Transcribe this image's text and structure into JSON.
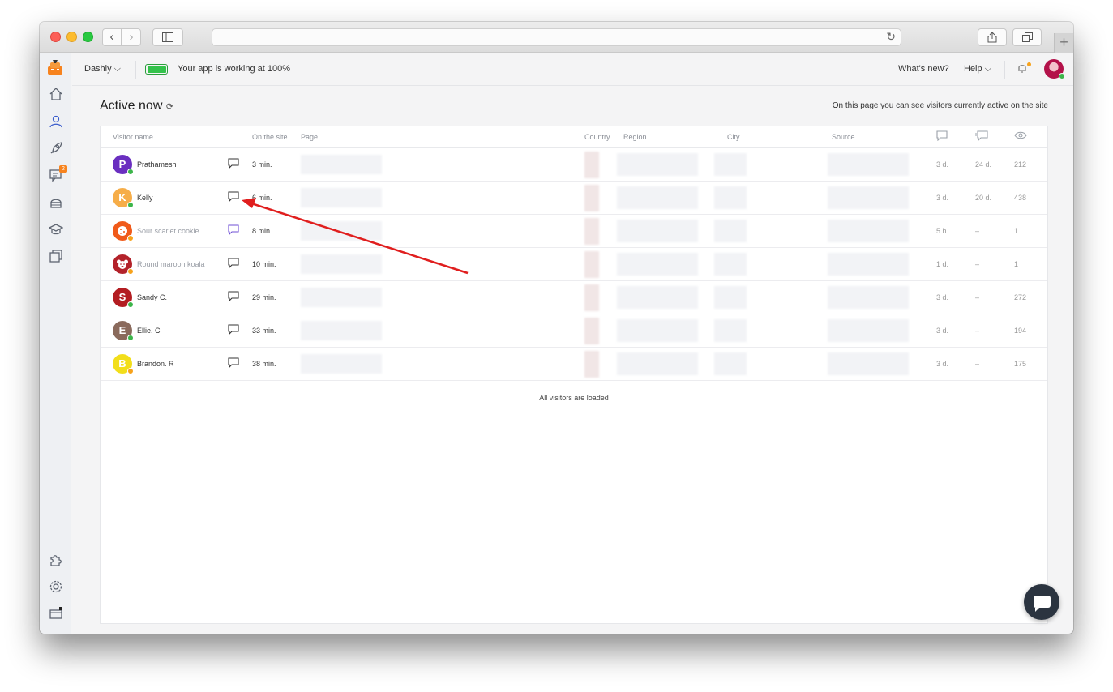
{
  "app": {
    "project": "Dashly ⌵",
    "status": "Your app is working at 100%",
    "battery_level": 1.0,
    "whats_new": "What's new?",
    "help": "Help ⌵"
  },
  "sidebar": {
    "items": [
      {
        "icon": "home-icon"
      },
      {
        "icon": "users-icon",
        "active": true
      },
      {
        "icon": "rocket-icon"
      },
      {
        "icon": "chats-icon",
        "badge": "2"
      },
      {
        "icon": "cake-icon"
      },
      {
        "icon": "graduation-cap-icon"
      },
      {
        "icon": "layers-icon"
      },
      {
        "icon": "puzzle-icon"
      },
      {
        "icon": "gear-icon"
      },
      {
        "icon": "billing-icon"
      }
    ]
  },
  "page": {
    "title": "Active now",
    "hint": "On this page you can see visitors currently active on the site"
  },
  "table": {
    "headers": {
      "visitor_name": "Visitor name",
      "on_site": "On the site",
      "page": "Page",
      "country": "Country",
      "region": "Region",
      "city": "City",
      "source": "Source"
    },
    "rows": [
      {
        "initial": "P",
        "color": "#6a2fc0",
        "status": "#3cb54a",
        "name": "Prathamesh",
        "anon": false,
        "time": "3 min.",
        "c1": "3 d.",
        "c2": "24 d.",
        "c3": "212"
      },
      {
        "initial": "K",
        "color": "#f6ad48",
        "status": "#3cb54a",
        "name": "Kelly",
        "anon": false,
        "time": "6 min.",
        "c1": "3 d.",
        "c2": "20 d.",
        "c3": "438"
      },
      {
        "initial": "",
        "color": "#f05a1a",
        "status": "#f7a21b",
        "name": "Sour scarlet cookie",
        "anon": true,
        "time": "8 min.",
        "c1": "5 h.",
        "c2": "–",
        "c3": "1"
      },
      {
        "initial": "",
        "color": "#b3222a",
        "status": "#f7a21b",
        "name": "Round maroon koala",
        "anon": true,
        "time": "10 min.",
        "c1": "1 d.",
        "c2": "–",
        "c3": "1"
      },
      {
        "initial": "S",
        "color": "#b31d22",
        "status": "#3cb54a",
        "name": "Sandy C.",
        "anon": false,
        "time": "29 min.",
        "c1": "3 d.",
        "c2": "–",
        "c3": "272"
      },
      {
        "initial": "E",
        "color": "#8a6a5c",
        "status": "#3cb54a",
        "name": "Ellie. C",
        "anon": false,
        "time": "33 min.",
        "c1": "3 d.",
        "c2": "–",
        "c3": "194"
      },
      {
        "initial": "B",
        "color": "#f2de1a",
        "status": "#f7a21b",
        "name": "Brandon. R",
        "anon": false,
        "time": "38 min.",
        "c1": "3 d.",
        "c2": "–",
        "c3": "175"
      }
    ],
    "footer": "All visitors are loaded"
  }
}
